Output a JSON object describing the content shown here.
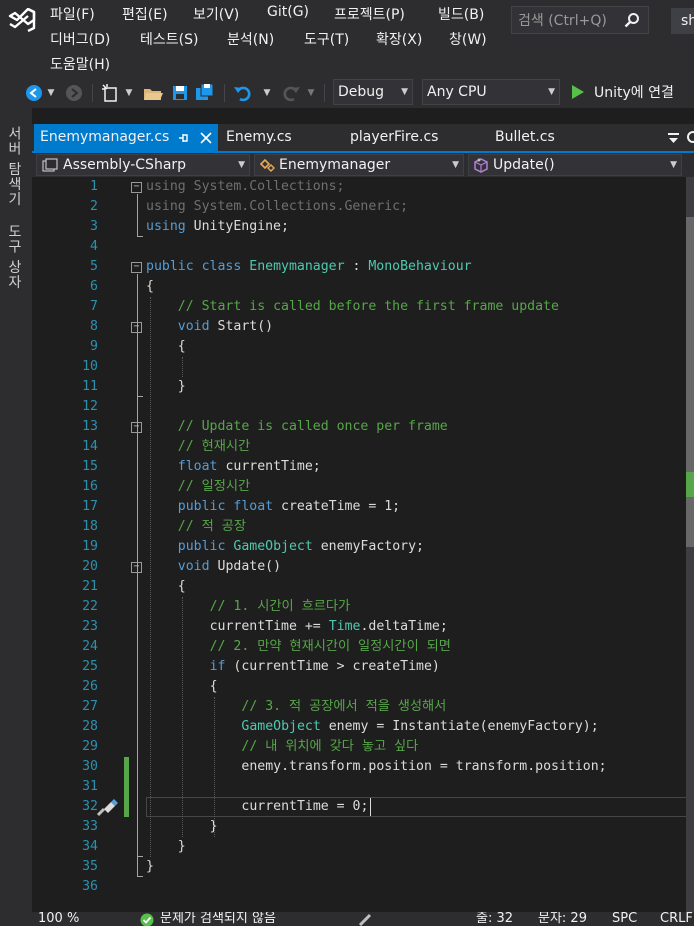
{
  "menu": {
    "file": "파일(F)",
    "edit": "편집(E)",
    "view": "보기(V)",
    "git": "Git(G)",
    "project": "프로젝트(P)",
    "build": "빌드(B)",
    "debug": "디버그(D)",
    "test": "테스트(S)",
    "analyze": "분석(N)",
    "tools": "도구(T)",
    "extensions": "확장(X)",
    "window": "창(W)",
    "help": "도움말(H)"
  },
  "search": {
    "placeholder": "검색 (Ctrl+Q)"
  },
  "profile": {
    "label": "sh"
  },
  "toolbar": {
    "config": "Debug",
    "platform": "Any CPU",
    "run_label": "Unity에 연결"
  },
  "side_panels": {
    "server_explorer": "서버 탐색기",
    "toolbox": "도구 상자"
  },
  "tabs": [
    {
      "label": "Enemymanager.cs",
      "active": true
    },
    {
      "label": "Enemy.cs"
    },
    {
      "label": "playerFire.cs"
    },
    {
      "label": "Bullet.cs"
    }
  ],
  "nav": {
    "project": "Assembly-CSharp",
    "type": "Enemymanager",
    "member": "Update()"
  },
  "code_lines": [
    "1",
    "2",
    "3",
    "4",
    "5",
    "6",
    "7",
    "8",
    "9",
    "10",
    "11",
    "12",
    "13",
    "14",
    "15",
    "16",
    "17",
    "18",
    "19",
    "20",
    "21",
    "22",
    "23",
    "24",
    "25",
    "26",
    "27",
    "28",
    "29",
    "30",
    "31",
    "32",
    "33",
    "34",
    "35",
    "36"
  ],
  "code": {
    "l1": [
      "using",
      " System.Collections;"
    ],
    "l2": [
      "using",
      " System.Collections.Generic;"
    ],
    "l3": [
      "using",
      " UnityEngine;"
    ],
    "l5": [
      "public",
      " ",
      "class",
      " ",
      "Enemymanager",
      " : ",
      "MonoBehaviour"
    ],
    "l6": "{",
    "l7": "// Start is called before the first frame update",
    "l8": [
      "void",
      " Start()"
    ],
    "l9": "{",
    "l11": "}",
    "l13": "// Update is called once per frame",
    "l14": "// 현재시간",
    "l15": [
      "float",
      " currentTime;"
    ],
    "l16": "// 일정시간",
    "l17": [
      "public",
      " ",
      "float",
      " createTime = 1;"
    ],
    "l18": "// 적 공장",
    "l19": [
      "public",
      " ",
      "GameObject",
      " enemyFactory;"
    ],
    "l20": [
      "void",
      " Update()"
    ],
    "l21": "{",
    "l22": "// 1. 시간이 흐르다가",
    "l23": [
      "currentTime += ",
      "Time",
      ".deltaTime;"
    ],
    "l24": "// 2. 만약 현재시간이 일정시간이 되면",
    "l25": [
      "if",
      " (currentTime > createTime)"
    ],
    "l26": "{",
    "l27": "// 3. 적 공장에서 적을 생성해서",
    "l28": [
      "GameObject",
      " enemy = Instantiate(enemyFactory);"
    ],
    "l29": "// 내 위치에 갖다 놓고 싶다",
    "l30": "enemy.transform.position = transform.position;",
    "l32": "currentTime = 0;",
    "l33": "}",
    "l34": "}",
    "l35": "}"
  },
  "status": {
    "zoom": "100 %",
    "issues": "문제가 검색되지 않음",
    "line": "줄: 32",
    "col": "문자: 29",
    "spc": "SPC",
    "eol": "CRLF"
  },
  "colors": {
    "accent": "#007acc",
    "keyword": "#569cd6",
    "type": "#4ec9b0",
    "comment": "#57a64a",
    "line_number": "#2b91af",
    "text": "#dcdcdc"
  }
}
